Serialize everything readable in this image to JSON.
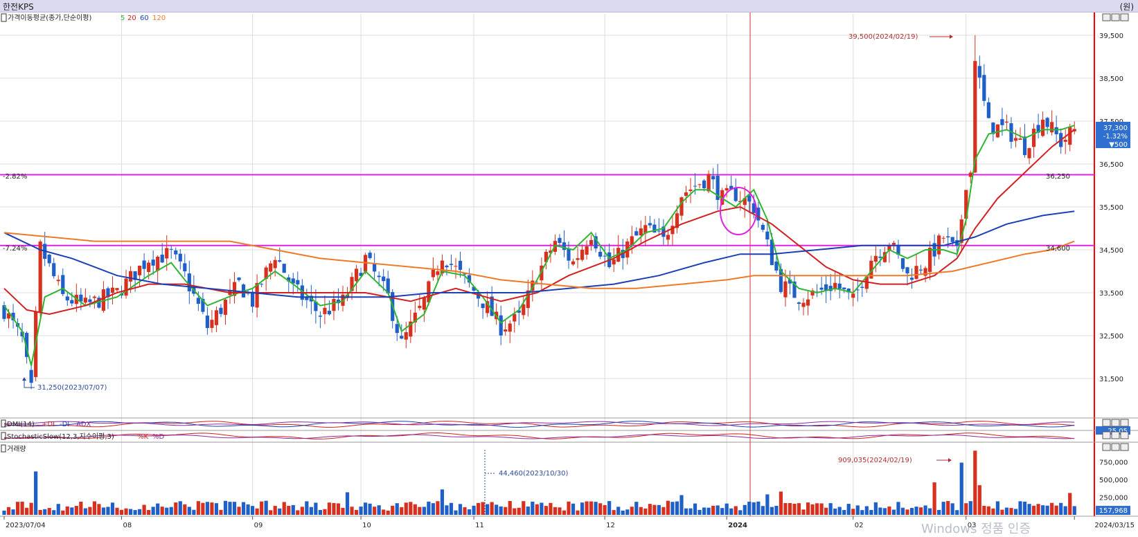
{
  "window": {
    "title": "한전KPS",
    "unit": "(원)"
  },
  "header": {
    "ma_title": "가격이동평균(종가,단순이평)",
    "ma_periods": [
      {
        "label": "5",
        "color": "#2fb52f"
      },
      {
        "label": "20",
        "color": "#d21f1f"
      },
      {
        "label": "60",
        "color": "#1b3fb4"
      },
      {
        "label": "120",
        "color": "#ee7a28"
      }
    ]
  },
  "panels": {
    "dmi": {
      "title": "DMI(14)",
      "legend": [
        {
          "label": "+DI",
          "color": "#d21f1f"
        },
        {
          "label": "-DI",
          "color": "#1b3fb4"
        },
        {
          "label": "ADX",
          "color": "#8a2b9b"
        }
      ],
      "value": "25.05"
    },
    "stoch": {
      "title": "StochasticSlow(12,3,지수이평,3)",
      "legend": [
        {
          "label": "%K",
          "color": "#d21f1f"
        },
        {
          "label": "%D",
          "color": "#8a2b9b"
        }
      ]
    },
    "volume": {
      "title": "거래량",
      "last": "157,968"
    }
  },
  "annotations": {
    "high": "39,500(2024/02/19)",
    "low": "31,250(2023/07/07)",
    "vol_high": "909,035(2024/02/19)",
    "vol_low": "44,460(2023/10/30)",
    "hline1_pct": "-2.82%",
    "hline1_value": "36,250",
    "hline2_pct": "-7.24%",
    "hline2_value": "34,600"
  },
  "current": {
    "price": "37,300",
    "change_pct": "-1.32%",
    "change": "▼500"
  },
  "colors": {
    "up": "#d7301f",
    "down": "#1f5fc8",
    "hline": "#e020e0",
    "frame": "#ff0000"
  },
  "chart_data": {
    "type": "candlestick",
    "title": "한전KPS",
    "x_range": [
      "2023/07/04",
      "2024/03/15"
    ],
    "x_ticks": [
      "2023/07/04",
      "08",
      "09",
      "10",
      "11",
      "12",
      "2024",
      "02",
      "03",
      "2024/03/15"
    ],
    "y_ticks": [
      "39,500",
      "38,500",
      "37,500",
      "36,500",
      "35,500",
      "34,500",
      "33,500",
      "32,500",
      "31,500"
    ],
    "ylim": [
      31000,
      40000
    ],
    "volume_ticks": [
      "750,000",
      "500,000",
      "250,000"
    ],
    "volume_ylim": [
      0,
      1000000
    ],
    "close_path": [
      [
        0,
        33100
      ],
      [
        4,
        32400
      ],
      [
        6,
        31250
      ],
      [
        8,
        34550
      ],
      [
        13,
        33400
      ],
      [
        18,
        33200
      ],
      [
        25,
        33500
      ],
      [
        32,
        34300
      ],
      [
        37,
        34400
      ],
      [
        40,
        33900
      ],
      [
        45,
        32700
      ],
      [
        52,
        33700
      ],
      [
        55,
        33300
      ],
      [
        60,
        34400
      ],
      [
        64,
        33600
      ],
      [
        70,
        33000
      ],
      [
        75,
        33300
      ],
      [
        80,
        34300
      ],
      [
        85,
        33400
      ],
      [
        88,
        32300
      ],
      [
        93,
        33300
      ],
      [
        97,
        34400
      ],
      [
        102,
        33800
      ],
      [
        106,
        33300
      ],
      [
        110,
        32700
      ],
      [
        114,
        32900
      ],
      [
        118,
        33900
      ],
      [
        122,
        34700
      ],
      [
        126,
        34200
      ],
      [
        130,
        34900
      ],
      [
        134,
        34100
      ],
      [
        138,
        34600
      ],
      [
        142,
        35000
      ],
      [
        146,
        34700
      ],
      [
        150,
        35800
      ],
      [
        153,
        36000
      ],
      [
        156,
        36200
      ],
      [
        159,
        35700
      ],
      [
        162,
        35800
      ],
      [
        166,
        35500
      ],
      [
        169,
        34600
      ],
      [
        172,
        33700
      ],
      [
        176,
        33400
      ],
      [
        180,
        33500
      ],
      [
        184,
        33700
      ],
      [
        188,
        33300
      ],
      [
        192,
        34300
      ],
      [
        196,
        34700
      ],
      [
        200,
        33900
      ],
      [
        204,
        34200
      ],
      [
        208,
        34800
      ],
      [
        211,
        34400
      ],
      [
        213,
        36100
      ],
      [
        215,
        38900
      ],
      [
        218,
        37400
      ],
      [
        222,
        37300
      ],
      [
        226,
        36900
      ],
      [
        230,
        37600
      ],
      [
        234,
        37000
      ],
      [
        237,
        37300
      ]
    ],
    "vol_spikes": [
      [
        7,
        615000
      ],
      [
        76,
        320000
      ],
      [
        97,
        360000
      ],
      [
        150,
        280000
      ],
      [
        169,
        290000
      ],
      [
        172,
        330000
      ],
      [
        206,
        460000
      ],
      [
        212,
        740000
      ],
      [
        215,
        909035
      ],
      [
        216,
        420000
      ],
      [
        236,
        310000
      ]
    ],
    "hlines": [
      36250,
      34600
    ],
    "ma": [
      {
        "name": "5",
        "color": "#2fb52f",
        "path": [
          [
            0,
            33200
          ],
          [
            4,
            32600
          ],
          [
            6,
            31800
          ],
          [
            9,
            33400
          ],
          [
            13,
            33600
          ],
          [
            18,
            33200
          ],
          [
            25,
            33400
          ],
          [
            32,
            33900
          ],
          [
            37,
            34200
          ],
          [
            40,
            33800
          ],
          [
            45,
            33200
          ],
          [
            52,
            33500
          ],
          [
            55,
            33600
          ],
          [
            60,
            34000
          ],
          [
            64,
            33700
          ],
          [
            70,
            33200
          ],
          [
            75,
            33300
          ],
          [
            80,
            34000
          ],
          [
            85,
            33500
          ],
          [
            88,
            32600
          ],
          [
            93,
            33000
          ],
          [
            97,
            34000
          ],
          [
            102,
            33900
          ],
          [
            106,
            33400
          ],
          [
            110,
            32800
          ],
          [
            114,
            33100
          ],
          [
            118,
            33800
          ],
          [
            122,
            34600
          ],
          [
            126,
            34500
          ],
          [
            130,
            34900
          ],
          [
            134,
            34300
          ],
          [
            138,
            34500
          ],
          [
            142,
            34900
          ],
          [
            146,
            35000
          ],
          [
            150,
            35600
          ],
          [
            153,
            35900
          ],
          [
            156,
            35900
          ],
          [
            159,
            35700
          ],
          [
            162,
            35500
          ],
          [
            166,
            35900
          ],
          [
            169,
            35200
          ],
          [
            172,
            34000
          ],
          [
            176,
            33600
          ],
          [
            180,
            33500
          ],
          [
            184,
            33600
          ],
          [
            188,
            33500
          ],
          [
            192,
            34000
          ],
          [
            196,
            34500
          ],
          [
            200,
            34300
          ],
          [
            204,
            34500
          ],
          [
            208,
            34500
          ],
          [
            211,
            34400
          ],
          [
            213,
            35200
          ],
          [
            215,
            36600
          ],
          [
            218,
            37200
          ],
          [
            222,
            37300
          ],
          [
            226,
            37100
          ],
          [
            230,
            37300
          ],
          [
            234,
            37300
          ],
          [
            237,
            37400
          ]
        ]
      },
      {
        "name": "20",
        "color": "#d21f1f",
        "path": [
          [
            0,
            33600
          ],
          [
            5,
            33100
          ],
          [
            10,
            33000
          ],
          [
            18,
            33200
          ],
          [
            25,
            33500
          ],
          [
            32,
            33700
          ],
          [
            40,
            33700
          ],
          [
            50,
            33500
          ],
          [
            60,
            33500
          ],
          [
            70,
            33500
          ],
          [
            80,
            33500
          ],
          [
            90,
            33300
          ],
          [
            100,
            33600
          ],
          [
            110,
            33300
          ],
          [
            118,
            33500
          ],
          [
            125,
            33900
          ],
          [
            135,
            34300
          ],
          [
            142,
            34700
          ],
          [
            150,
            35100
          ],
          [
            158,
            35400
          ],
          [
            163,
            35500
          ],
          [
            170,
            35100
          ],
          [
            176,
            34600
          ],
          [
            182,
            34100
          ],
          [
            188,
            33800
          ],
          [
            194,
            33700
          ],
          [
            200,
            33700
          ],
          [
            206,
            33900
          ],
          [
            211,
            34300
          ],
          [
            215,
            35000
          ],
          [
            220,
            35700
          ],
          [
            226,
            36300
          ],
          [
            232,
            36900
          ],
          [
            237,
            37300
          ]
        ]
      },
      {
        "name": "60",
        "color": "#1b3fb4",
        "path": [
          [
            0,
            34900
          ],
          [
            8,
            34500
          ],
          [
            15,
            34300
          ],
          [
            25,
            33900
          ],
          [
            35,
            33700
          ],
          [
            45,
            33600
          ],
          [
            55,
            33500
          ],
          [
            65,
            33400
          ],
          [
            75,
            33400
          ],
          [
            85,
            33400
          ],
          [
            95,
            33500
          ],
          [
            105,
            33500
          ],
          [
            115,
            33500
          ],
          [
            125,
            33600
          ],
          [
            135,
            33700
          ],
          [
            145,
            33900
          ],
          [
            155,
            34200
          ],
          [
            163,
            34400
          ],
          [
            170,
            34400
          ],
          [
            180,
            34500
          ],
          [
            190,
            34600
          ],
          [
            200,
            34600
          ],
          [
            208,
            34600
          ],
          [
            215,
            34800
          ],
          [
            222,
            35100
          ],
          [
            230,
            35300
          ],
          [
            237,
            35400
          ]
        ]
      },
      {
        "name": "120",
        "color": "#ee7a28",
        "path": [
          [
            0,
            34900
          ],
          [
            10,
            34800
          ],
          [
            20,
            34700
          ],
          [
            30,
            34700
          ],
          [
            40,
            34700
          ],
          [
            50,
            34700
          ],
          [
            60,
            34500
          ],
          [
            70,
            34300
          ],
          [
            80,
            34200
          ],
          [
            90,
            34100
          ],
          [
            100,
            34000
          ],
          [
            110,
            33800
          ],
          [
            120,
            33700
          ],
          [
            130,
            33600
          ],
          [
            140,
            33600
          ],
          [
            150,
            33700
          ],
          [
            160,
            33800
          ],
          [
            166,
            33900
          ],
          [
            172,
            33900
          ],
          [
            180,
            33900
          ],
          [
            190,
            33900
          ],
          [
            200,
            33900
          ],
          [
            210,
            34000
          ],
          [
            218,
            34200
          ],
          [
            226,
            34400
          ],
          [
            232,
            34500
          ],
          [
            237,
            34700
          ]
        ]
      }
    ]
  }
}
